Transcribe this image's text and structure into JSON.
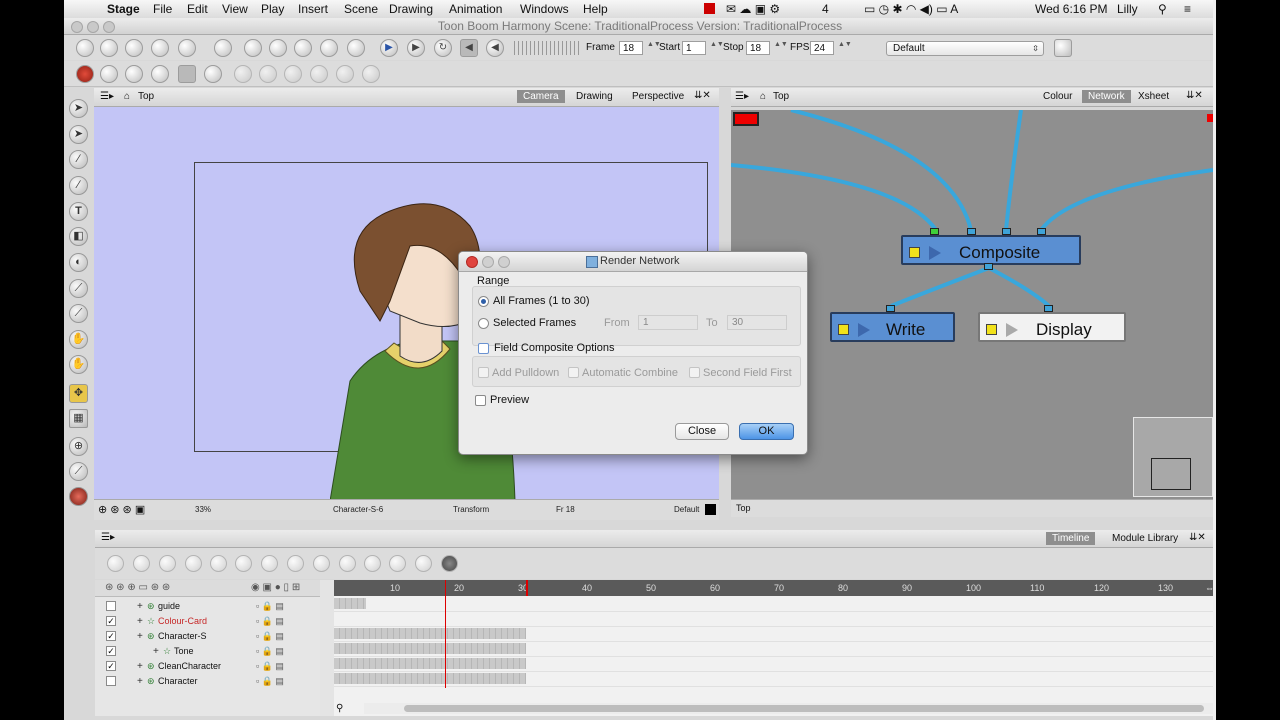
{
  "menubar": {
    "app": "Stage",
    "items": [
      "File",
      "Edit",
      "View",
      "Play",
      "Insert",
      "Scene",
      "Drawing",
      "Animation",
      "Windows",
      "Help"
    ],
    "status": {
      "adobe_badge": "4",
      "clock": "Wed 6:16 PM",
      "user": "Lilly"
    }
  },
  "window": {
    "title": "Toon Boom Harmony Scene: TraditionalProcess Version: TraditionalProcess"
  },
  "playback": {
    "frame_label": "Frame",
    "frame_value": "18",
    "start_label": "Start",
    "start_value": "1",
    "stop_label": "Stop",
    "stop_value": "18",
    "fps_label": "FPS",
    "fps_value": "24",
    "preset": "Default"
  },
  "camera_panel": {
    "view": "Top",
    "tabs": [
      "Camera",
      "Drawing",
      "Perspective"
    ],
    "active_tab": "Camera",
    "status": {
      "zoom": "33%",
      "layer": "Character-S-6",
      "tool": "Transform",
      "frame": "Fr 18",
      "preset": "Default"
    }
  },
  "network_panel": {
    "view": "Top",
    "tabs": [
      "Colour",
      "Network",
      "Xsheet"
    ],
    "active_tab": "Network",
    "nodes": {
      "composite": "Composite",
      "write": "Write",
      "display": "Display"
    },
    "status": "Top"
  },
  "dialog": {
    "title": "Render Network",
    "range_label": "Range",
    "all_frames": "All Frames (1 to 30)",
    "selected_frames": "Selected Frames",
    "from_label": "From",
    "from_value": "1",
    "to_label": "To",
    "to_value": "30",
    "field_composite": "Field Composite Options",
    "add_pulldown": "Add Pulldown",
    "auto_combine": "Automatic Combine",
    "second_field": "Second Field First",
    "preview": "Preview",
    "close": "Close",
    "ok": "OK"
  },
  "timeline": {
    "tabs": [
      "Timeline",
      "Module Library"
    ],
    "active_tab": "Timeline",
    "ruler": [
      "10",
      "20",
      "30",
      "40",
      "50",
      "60",
      "70",
      "80",
      "90",
      "100",
      "110",
      "120",
      "130"
    ],
    "current_frame": 18,
    "layers": [
      {
        "name": "guide",
        "checked": false,
        "color": "#111111"
      },
      {
        "name": "Colour-Card",
        "checked": true,
        "color": "#c62828"
      },
      {
        "name": "Character-S",
        "checked": true,
        "color": "#111111"
      },
      {
        "name": "Tone",
        "checked": true,
        "color": "#111111"
      },
      {
        "name": "CleanCharacter",
        "checked": true,
        "color": "#111111"
      },
      {
        "name": "Character",
        "checked": false,
        "color": "#111111"
      }
    ]
  }
}
